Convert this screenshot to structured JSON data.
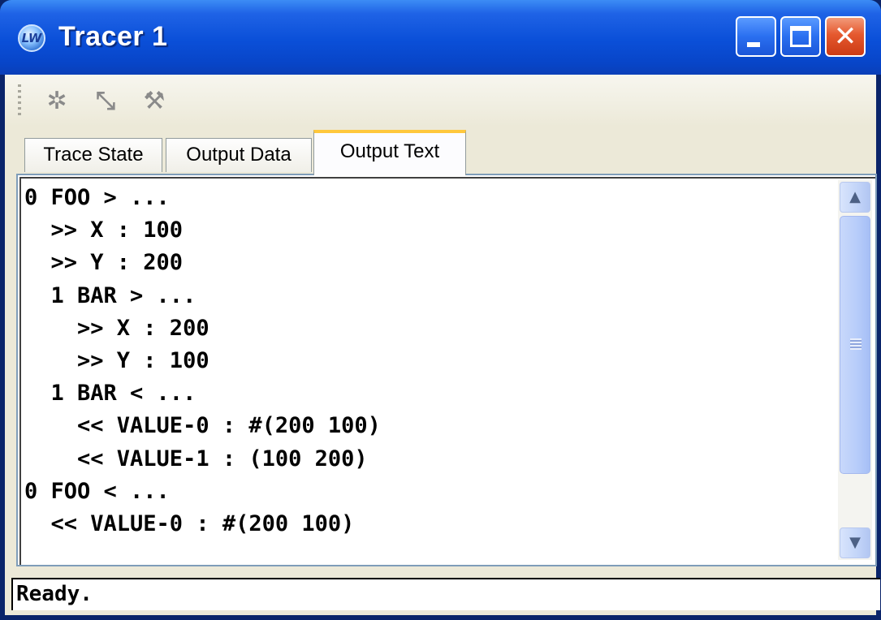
{
  "window": {
    "title": "Tracer 1",
    "app_icon": "LW",
    "controls": [
      "minimize-icon",
      "maximize-icon",
      "close-icon"
    ]
  },
  "toolbar": {
    "buttons": [
      {
        "name": "trace-toggle-icon",
        "glyph": "✲"
      },
      {
        "name": "trace-step-icon",
        "glyph": "⤡"
      },
      {
        "name": "trace-clear-icon",
        "glyph": "⚒"
      }
    ]
  },
  "tabs": [
    {
      "label": "Trace State",
      "active": false
    },
    {
      "label": "Output Data",
      "active": false
    },
    {
      "label": "Output Text",
      "active": true
    }
  ],
  "output_text": {
    "lines": [
      "0 FOO > ...",
      "  >> X : 100",
      "  >> Y : 200",
      "  1 BAR > ...",
      "    >> X : 200",
      "    >> Y : 100",
      "  1 BAR < ...",
      "    << VALUE-0 : #(200 100)",
      "    << VALUE-1 : (100 200)",
      "0 FOO < ...",
      "  << VALUE-0 : #(200 100)"
    ]
  },
  "scrollbar": {
    "up": "▲",
    "down": "▼"
  },
  "status": {
    "text": "Ready."
  },
  "colors": {
    "titlebar": "#0a4fd8",
    "active_tab_accent": "#ffc83c",
    "window_bg": "#ece9d8"
  }
}
